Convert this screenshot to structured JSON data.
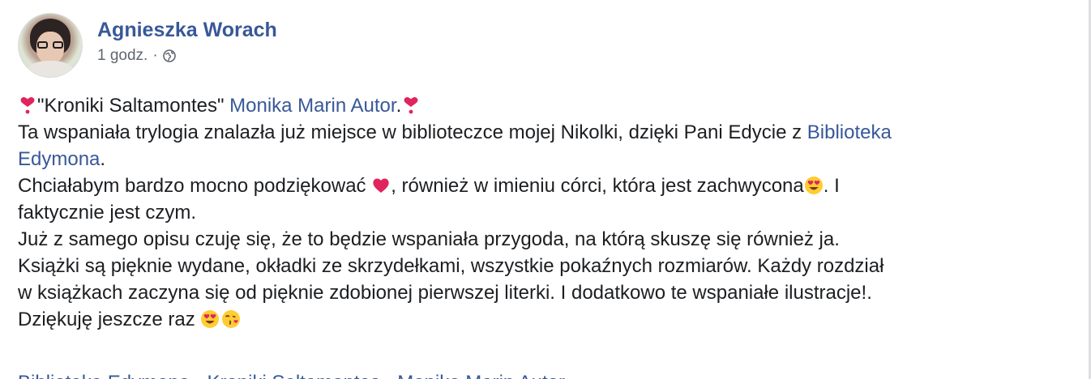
{
  "post": {
    "author": "Agnieszka Worach",
    "time": "1 godz.",
    "separator": "·",
    "audience_icon": "globe-icon",
    "lines": {
      "l1_pre": "\"Kroniki Saltamontes\" ",
      "l1_link": "Monika Marin Autor",
      "l1_post": ".",
      "l2_pre": "Ta wspaniała trylogia znalazła już miejsce w biblioteczce mojej Nikolki, dzięki Pani Edycie z ",
      "l2_link": "Biblioteka",
      "l3_link": "Edymona",
      "l3_post": ".",
      "l4_pre": "Chciałabym bardzo mocno podziękować ",
      "l4_mid": ", również w imieniu córci, która jest zachwycona",
      "l4_post": ". I",
      "l5": "faktycznie jest czym.",
      "l6": "Już z samego opisu czuję się, że to będzie wspaniała przygoda, na którą skuszę się również ja.",
      "l7": "Książki są pięknie wydane, okładki ze skrzydełkami, wszystkie pokaźnych rozmiarów. Każdy rozdział",
      "l8": "w książkach zaczyna się od pięknie zdobionej pierwszej literki. I dodatkowo te wspaniałe ilustracje!.",
      "l9": "Dziękuję jeszcze raz "
    },
    "cut_off_tags": "Biblioteka Edymona · Kroniki Saltamontes · Monika Marin Autor"
  },
  "colors": {
    "link": "#385898",
    "text": "#1c1e21",
    "meta": "#606770",
    "heart": "#e0245e"
  }
}
